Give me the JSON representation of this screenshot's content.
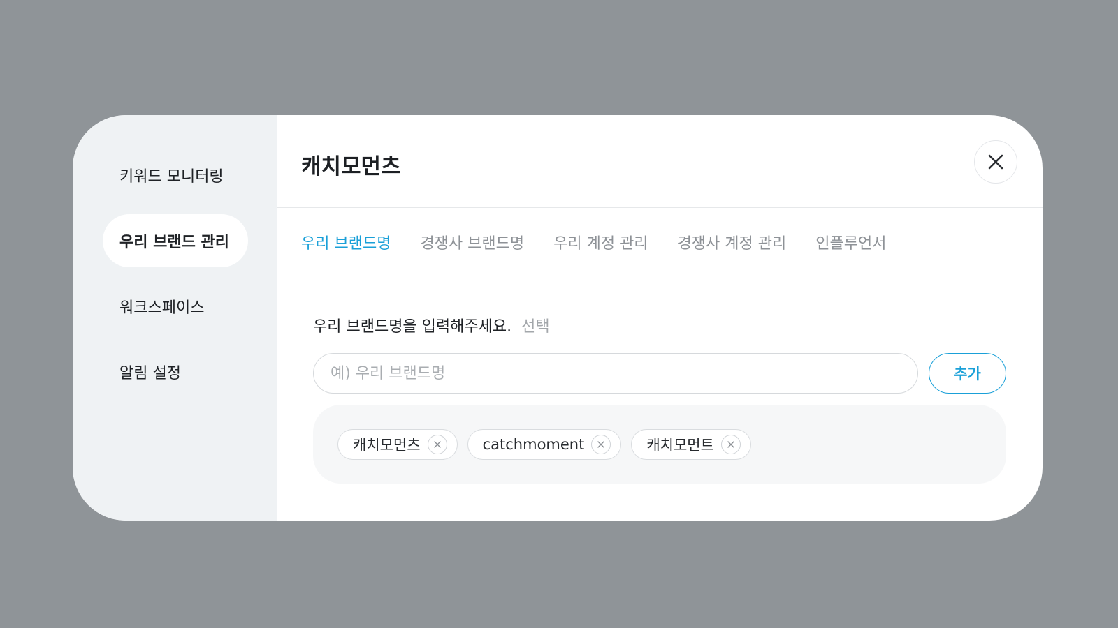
{
  "sidebar": {
    "items": [
      {
        "label": "키워드 모니터링",
        "active": false
      },
      {
        "label": "우리 브랜드 관리",
        "active": true
      },
      {
        "label": "워크스페이스",
        "active": false
      },
      {
        "label": "알림 설정",
        "active": false
      }
    ]
  },
  "header": {
    "title": "캐치모먼츠",
    "close_icon": "close-icon"
  },
  "tabs": [
    {
      "label": "우리 브랜드명",
      "active": true
    },
    {
      "label": "경쟁사 브랜드명",
      "active": false
    },
    {
      "label": "우리 계정 관리",
      "active": false
    },
    {
      "label": "경쟁사 계정 관리",
      "active": false
    },
    {
      "label": "인플루언서",
      "active": false
    }
  ],
  "form": {
    "label": "우리 브랜드명을 입력해주세요.",
    "optional": "선택",
    "input_value": "",
    "input_placeholder": "예) 우리 브랜드명",
    "add_label": "추가"
  },
  "tags": [
    {
      "label": "캐치모먼츠"
    },
    {
      "label": "catchmoment"
    },
    {
      "label": "캐치모먼트"
    }
  ],
  "colors": {
    "accent": "#1aa0d8",
    "backdrop": "#8f9498",
    "sidebar_bg": "#eff2f4"
  }
}
